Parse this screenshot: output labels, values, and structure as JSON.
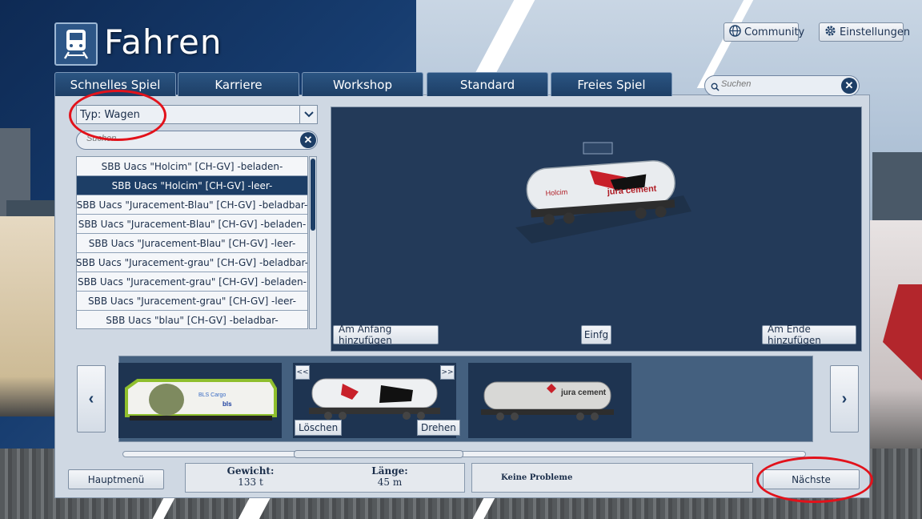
{
  "header": {
    "title": "Fahren",
    "community_label": "Community",
    "settings_label": "Einstellungen"
  },
  "tabs": [
    {
      "label": "Schnelles Spiel"
    },
    {
      "label": "Karriere"
    },
    {
      "label": "Workshop"
    },
    {
      "label": "Standard"
    },
    {
      "label": "Freies Spiel"
    }
  ],
  "search_top": {
    "placeholder": "Suchen"
  },
  "filter": {
    "type_label": "Typ: Wagen",
    "search_placeholder": "Suchen"
  },
  "list": {
    "items": [
      "SBB Uacs \"Holcim\" [CH-GV] -beladen-",
      "SBB Uacs \"Holcim\" [CH-GV] -leer-",
      "SBB Uacs \"Juracement-Blau\" [CH-GV] -beladbar-",
      "SBB Uacs \"Juracement-Blau\" [CH-GV] -beladen-",
      "SBB Uacs \"Juracement-Blau\" [CH-GV] -leer-",
      "SBB Uacs \"Juracement-grau\" [CH-GV] -beladbar-",
      "SBB Uacs \"Juracement-grau\" [CH-GV] -beladen-",
      "SBB Uacs \"Juracement-grau\" [CH-GV] -leer-",
      "SBB Uacs \"blau\" [CH-GV] -beladbar-"
    ],
    "selected_index": 1
  },
  "preview": {
    "wagon_text": "jura cement",
    "wagon_logo": "Holcim",
    "add_first_label": "Am Anfang hinzufügen",
    "insert_label": "Einfg",
    "add_last_label": "Am Ende hinzufügen"
  },
  "consist": {
    "loco_text": "BLS Cargo",
    "loco_logo": "bls",
    "move_left_label": "<<",
    "move_right_label": ">>",
    "delete_label": "Löschen",
    "rotate_label": "Drehen",
    "wagon3_text": "jura cement"
  },
  "stats": {
    "weight_label": "Gewicht:",
    "weight_value": "133 t",
    "length_label": "Länge:",
    "length_value": "45 m",
    "problems": "Keine Probleme"
  },
  "footer": {
    "main_menu_label": "Hauptmenü",
    "next_label": "Nächste"
  },
  "colors": {
    "accent": "#1d3e66",
    "annotation": "#e2121b",
    "panel": "#cfd8e3"
  },
  "icons": [
    "train-icon",
    "globe-icon",
    "gear-icon",
    "search-icon",
    "close-icon",
    "chevron-down-icon",
    "chevron-left-icon",
    "chevron-right-icon"
  ]
}
